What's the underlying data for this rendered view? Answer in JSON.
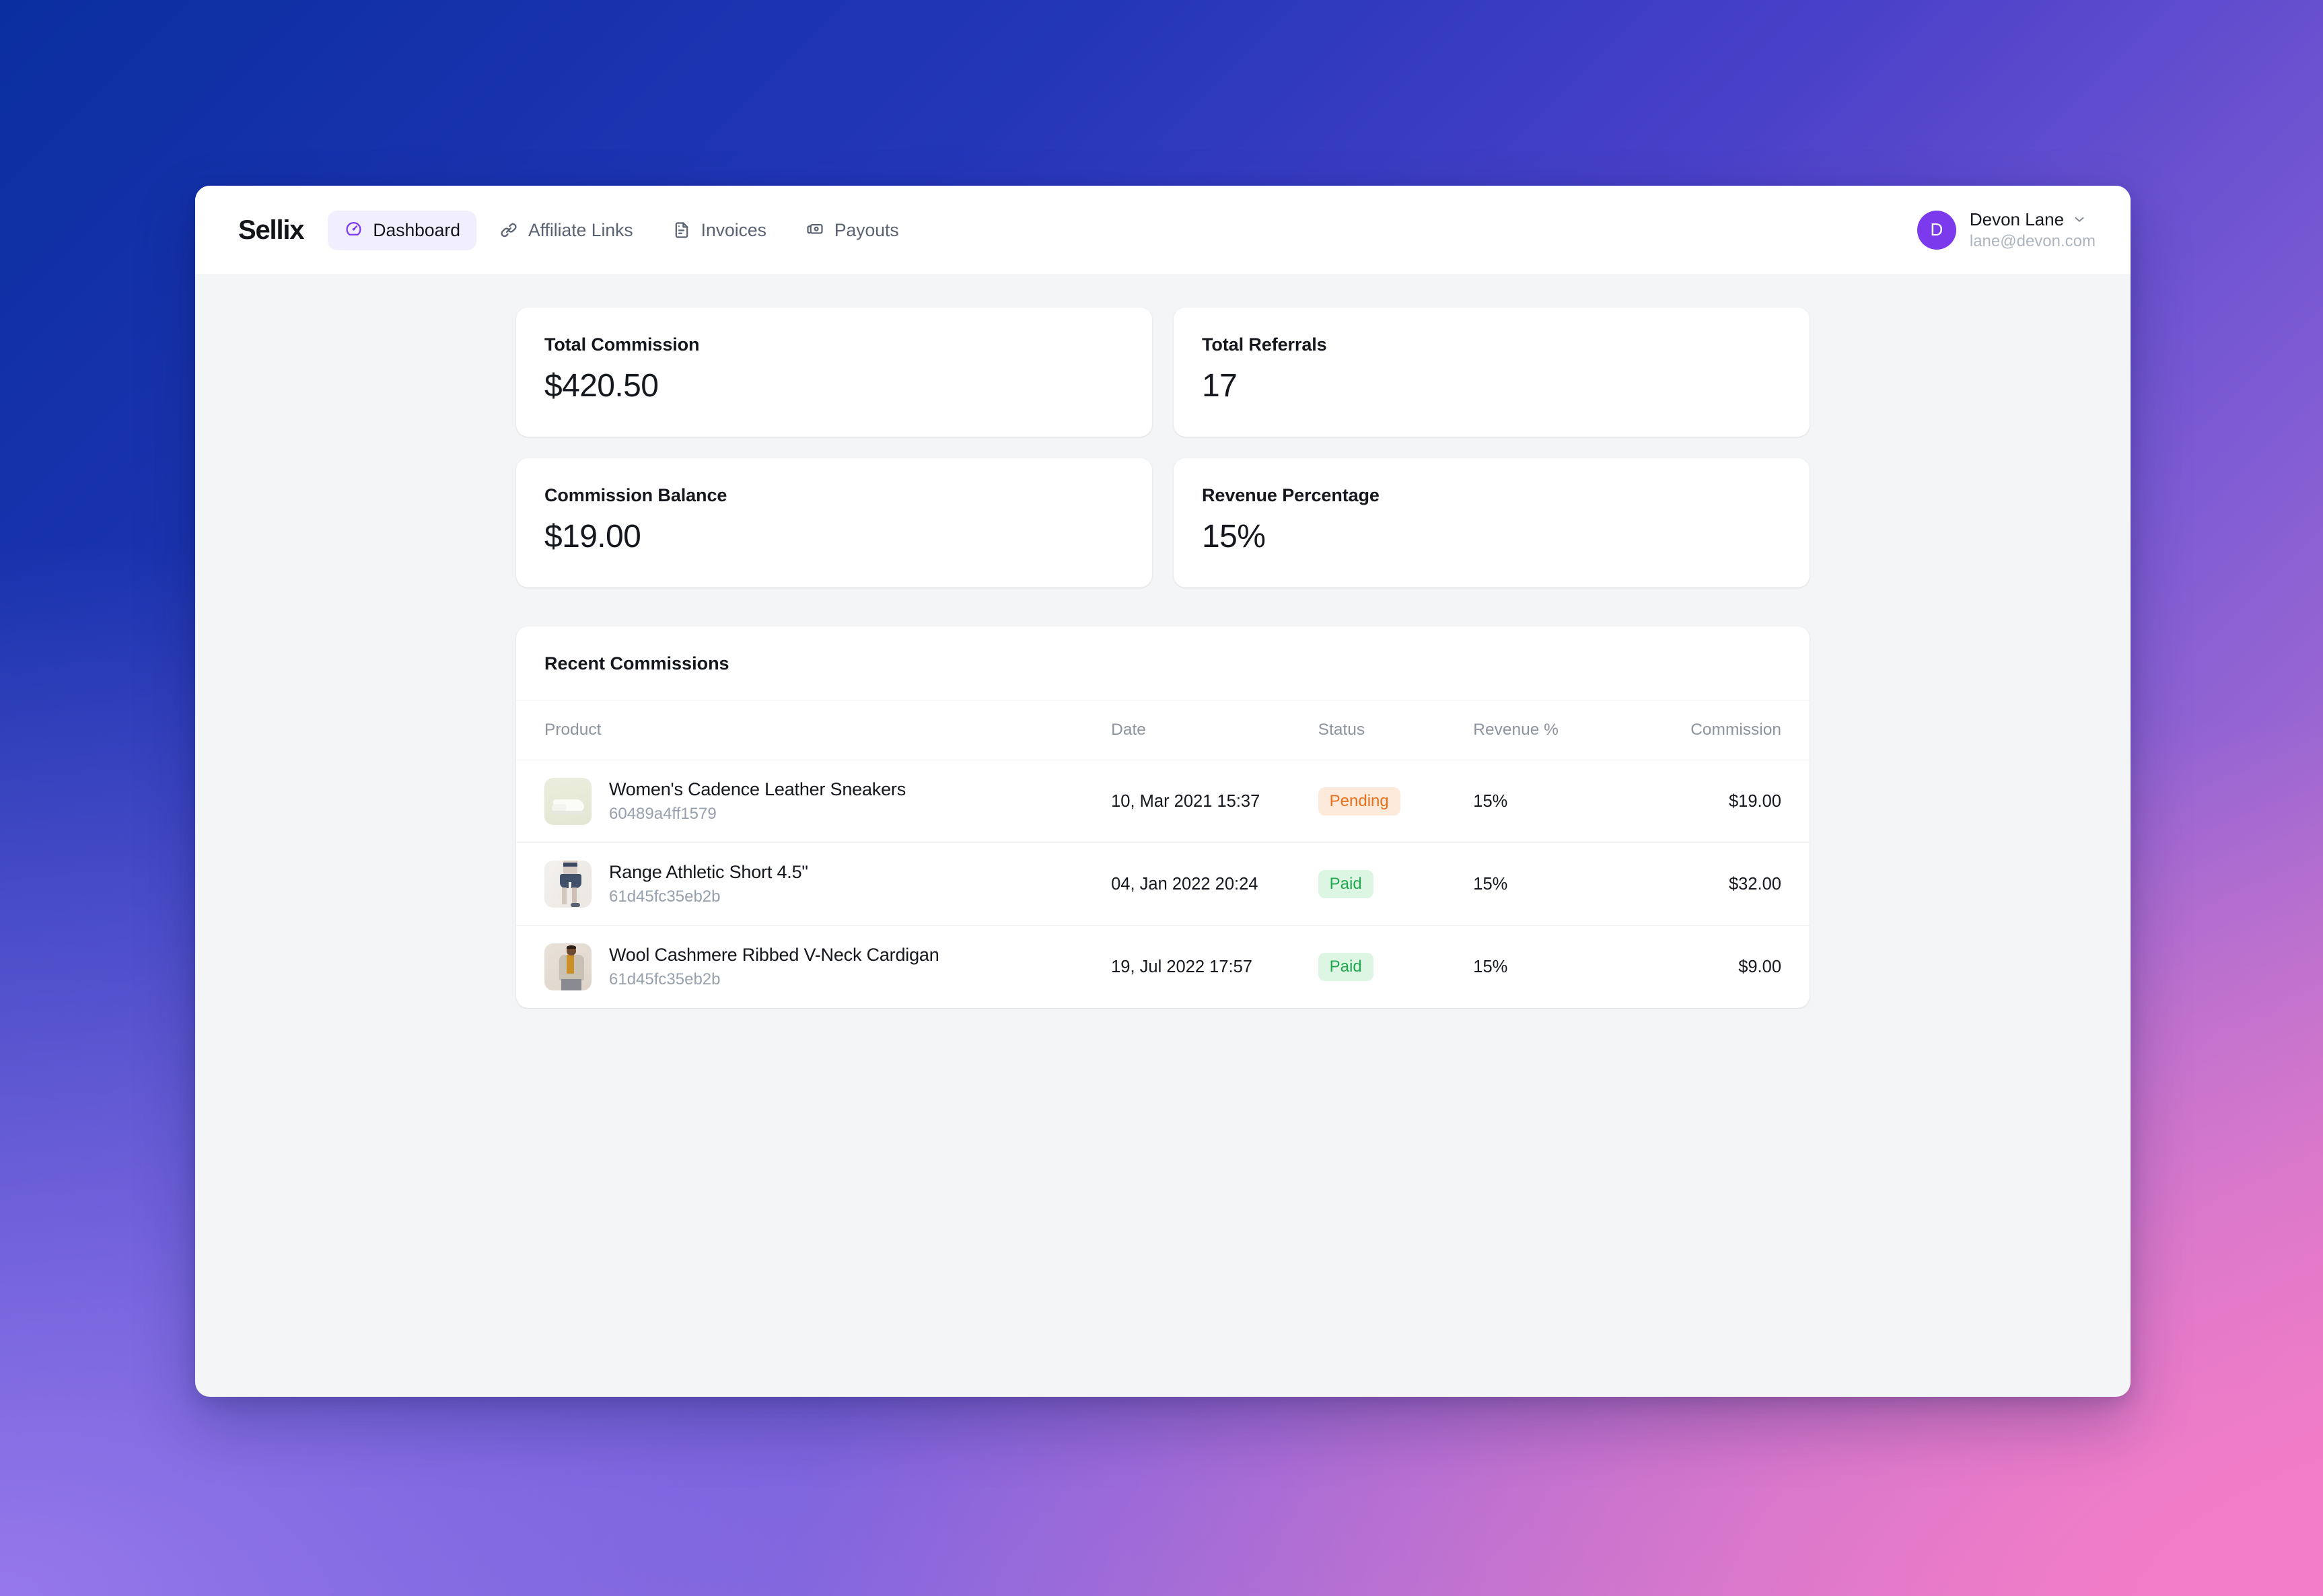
{
  "brand": {
    "name": "Sellix"
  },
  "nav": {
    "items": [
      {
        "label": "Dashboard",
        "icon": "gauge-icon",
        "active": true
      },
      {
        "label": "Affiliate Links",
        "icon": "link-icon",
        "active": false
      },
      {
        "label": "Invoices",
        "icon": "document-icon",
        "active": false
      },
      {
        "label": "Payouts",
        "icon": "cash-stack-icon",
        "active": false
      }
    ],
    "active_bg": "#f1effe",
    "active_accent": "#7c3aed"
  },
  "user": {
    "initial": "D",
    "name": "Devon Lane",
    "email": "lane@devon.com",
    "avatar_color": "#7c3aed",
    "chevron": "chevron-down-icon"
  },
  "stats": [
    {
      "label": "Total Commission",
      "value": "$420.50"
    },
    {
      "label": "Total Referrals",
      "value": "17"
    },
    {
      "label": "Commission Balance",
      "value": "$19.00"
    },
    {
      "label": "Revenue Percentage",
      "value": "15%"
    }
  ],
  "table": {
    "title": "Recent Commissions",
    "columns": [
      "Product",
      "Date",
      "Status",
      "Revenue %",
      "Commission"
    ],
    "rows": [
      {
        "product": "Women's Cadence Leather Sneakers",
        "product_id": "60489a4ff1579",
        "thumb": "sneaker-thumbnail",
        "date": "10, Mar 2021 15:37",
        "status": "Pending",
        "status_type": "pending",
        "revenue": "15%",
        "commission": "$19.00"
      },
      {
        "product": "Range Athletic Short 4.5\"",
        "product_id": "61d45fc35eb2b",
        "thumb": "shorts-thumbnail",
        "date": "04, Jan 2022 20:24",
        "status": "Paid",
        "status_type": "paid",
        "revenue": "15%",
        "commission": "$32.00"
      },
      {
        "product": "Wool Cashmere Ribbed V-Neck Cardigan",
        "product_id": "61d45fc35eb2b",
        "thumb": "cardigan-thumbnail",
        "date": "19, Jul 2022 17:57",
        "status": "Paid",
        "status_type": "paid",
        "revenue": "15%",
        "commission": "$9.00"
      }
    ]
  },
  "colors": {
    "status_pending_text": "#e8701c",
    "status_pending_bg": "#fdeadb",
    "status_paid_text": "#1fa84e",
    "status_paid_bg": "#ddf6e3",
    "accent": "#7c3aed",
    "page_bg_start": "#0a2ea0",
    "page_bg_end": "#ee7dc4"
  }
}
